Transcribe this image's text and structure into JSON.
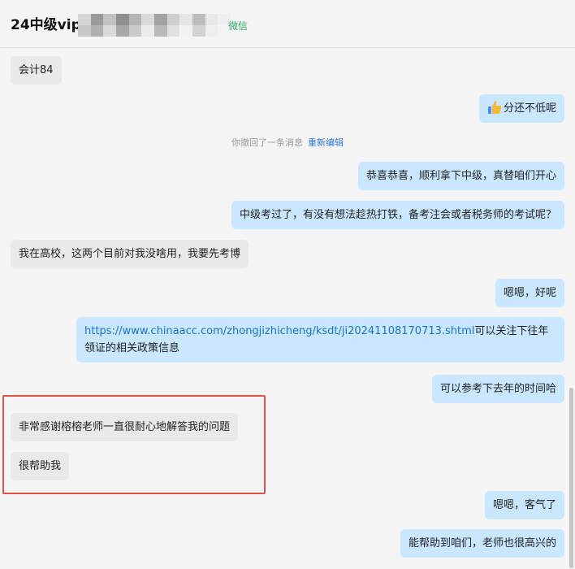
{
  "header": {
    "title": "24中级vip",
    "wechat_tag": "微信"
  },
  "recall_notice": {
    "text": "你撤回了一条消息",
    "reedit": "重新编辑"
  },
  "messages": [
    {
      "side": "left",
      "text": "会计84"
    },
    {
      "side": "right",
      "text": "分还不低呢",
      "icon": "thumbs-up-icon"
    },
    {
      "side": "right",
      "text": "恭喜恭喜，顺利拿下中级，真替咱们开心"
    },
    {
      "side": "right",
      "text": "中级考过了，有没有想法趁热打铁，备考注会或者税务师的考试呢？"
    },
    {
      "side": "left",
      "text": "我在高校，这两个目前对我没啥用，我要先考博"
    },
    {
      "side": "right",
      "text": "嗯嗯，好呢"
    },
    {
      "side": "right",
      "link": "https://www.chinaacc.com/zhongjizhicheng/ksdt/ji20241108170713.shtml",
      "text": "可以关注下往年领证的相关政策信息"
    },
    {
      "side": "right",
      "text": "可以参考下去年的时间哈"
    },
    {
      "side": "left",
      "text": "非常感谢榕榕老师一直很耐心地解答我的问题"
    },
    {
      "side": "left",
      "text": "很帮助我"
    },
    {
      "side": "right",
      "text": "嗯嗯，客气了"
    },
    {
      "side": "right",
      "text": "能帮助到咱们，老师也很高兴的"
    }
  ],
  "colors": {
    "left_bubble": "#e9e9e9",
    "right_bubble": "#c9e7fe",
    "link": "#1a73c9",
    "highlight": "#e0514a",
    "wechat_green": "#2aae67"
  }
}
